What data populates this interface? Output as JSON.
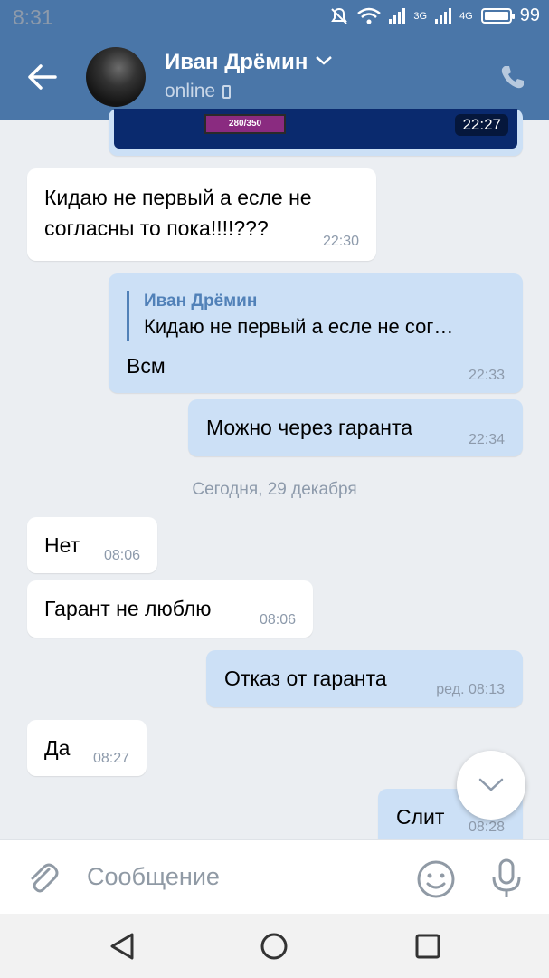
{
  "status_bar": {
    "time": "8:31",
    "network_3g": "3G",
    "network_4g": "4G",
    "battery": "99"
  },
  "header": {
    "contact_name": "Иван Дрёмин",
    "status": "online"
  },
  "messages": [
    {
      "direction": "outgoing",
      "type": "image",
      "time": "22:27"
    },
    {
      "direction": "incoming",
      "lines": [
        "Кидаю не первый а есле не",
        "согласны то пока!!!!???"
      ],
      "time": "22:30"
    },
    {
      "direction": "outgoing",
      "reply_to_name": "Иван Дрёмин",
      "reply_to_text": "Кидаю не первый а есле не сог…",
      "text": "Всм",
      "time": "22:33"
    },
    {
      "direction": "outgoing",
      "text": "Можно через гаранта",
      "time": "22:34"
    },
    {
      "direction": "incoming",
      "text": "Нет",
      "time": "08:06"
    },
    {
      "direction": "incoming",
      "text": "Гарант не люблю",
      "time": "08:06"
    },
    {
      "direction": "outgoing",
      "text": "Отказ от гаранта",
      "time": "ред. 08:13"
    },
    {
      "direction": "incoming",
      "text": "Да",
      "time": "08:27"
    },
    {
      "direction": "outgoing",
      "text": "Слит",
      "time": "08:28"
    }
  ],
  "date_separator": "Сегодня, 29 декабря",
  "image_preview_text": "280/350",
  "input": {
    "placeholder": "Сообщение"
  },
  "icons": {
    "back": "back-arrow-icon",
    "call": "phone-icon",
    "attach": "paperclip-icon",
    "emoji": "emoji-icon",
    "voice": "microphone-icon",
    "scroll": "chevron-down-icon"
  },
  "colors": {
    "header": "#4a76a8",
    "outgoing_bubble": "#cce0f6",
    "incoming_bubble": "#ffffff",
    "chat_background": "#ebeef2",
    "accent": "#5181b8"
  }
}
